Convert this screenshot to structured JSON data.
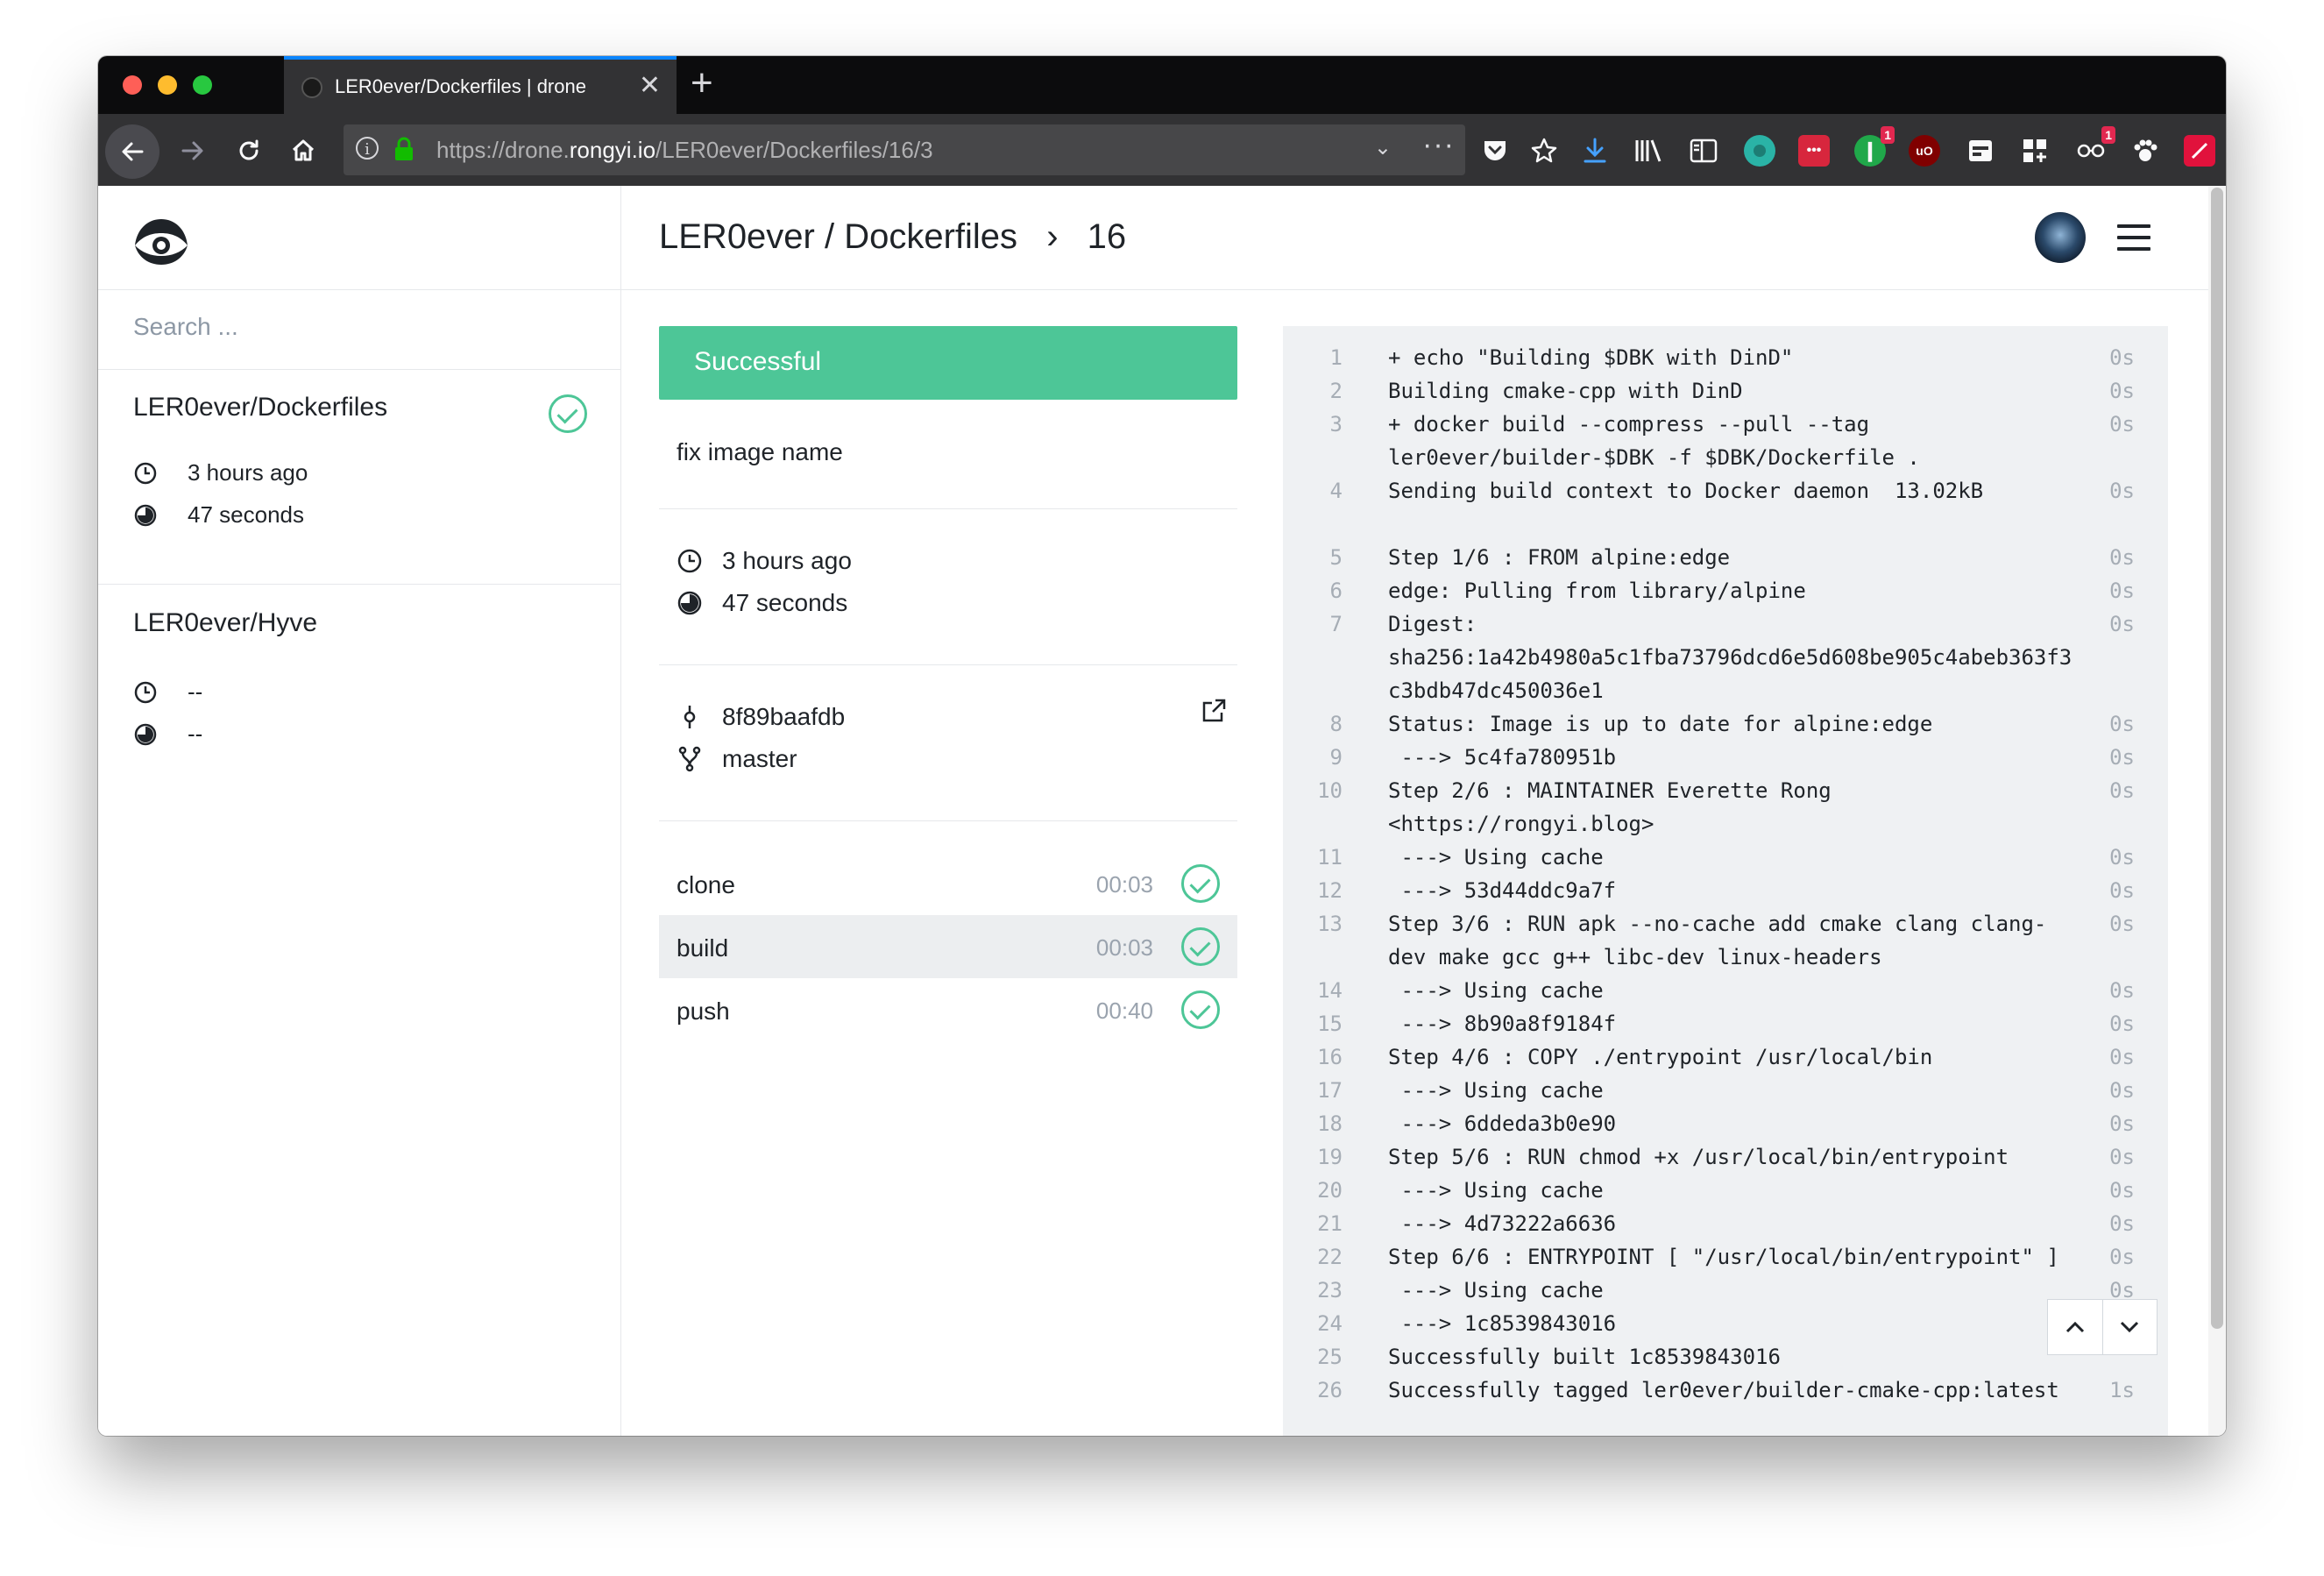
{
  "browser": {
    "tab_title": "LER0ever/Dockerfiles | drone",
    "close_glyph": "✕",
    "new_tab_glyph": "+",
    "url_host_prefix": "https://drone.",
    "url_host_domain": "rongyi.io",
    "url_path": "/LER0ever/Dockerfiles/16/3",
    "toolbar_icons": [
      "download-icon",
      "library-icon",
      "sidebar-icon",
      "extension-teal-icon",
      "extension-red-icon",
      "extension-green-icon",
      "ublock-icon",
      "extension-window-icon",
      "extension-grid-icon",
      "extension-glasses-icon",
      "extension-paw-icon",
      "extension-wand-icon",
      "react-icon",
      "menu-icon"
    ],
    "badges": {
      "green": "1",
      "glasses": "1",
      "red": "1"
    }
  },
  "sidebar": {
    "search_placeholder": "Search ...",
    "repos": [
      {
        "name": "LER0ever/Dockerfiles",
        "time": "3 hours ago",
        "duration": "47 seconds",
        "status": "success"
      },
      {
        "name": "LER0ever/Hyve",
        "time": "--",
        "duration": "--"
      }
    ]
  },
  "header": {
    "owner": "LER0ever",
    "separator": " / ",
    "repo": "Dockerfiles",
    "chevron": "›",
    "build_number": "16"
  },
  "build": {
    "status": "Successful",
    "status_color": "#4dc697",
    "message": "fix image name",
    "time": "3 hours ago",
    "duration": "47 seconds",
    "commit": "8f89baafdb",
    "branch": "master",
    "steps": [
      {
        "name": "clone",
        "duration": "00:03",
        "status": "success"
      },
      {
        "name": "build",
        "duration": "00:03",
        "status": "success",
        "active": true
      },
      {
        "name": "push",
        "duration": "00:40",
        "status": "success"
      }
    ]
  },
  "logs": [
    {
      "num": "1",
      "text": "+ echo \"Building $DBK with DinD\"",
      "time": "0s"
    },
    {
      "num": "2",
      "text": "Building cmake-cpp with DinD",
      "time": "0s"
    },
    {
      "num": "3",
      "text": "+ docker build --compress --pull --tag",
      "time": "0s"
    },
    {
      "num": "",
      "text": "ler0ever/builder-$DBK -f $DBK/Dockerfile .",
      "time": ""
    },
    {
      "num": "4",
      "text": "Sending build context to Docker daemon  13.02kB",
      "time": "0s"
    },
    {
      "num": "",
      "text": "",
      "time": ""
    },
    {
      "num": "5",
      "text": "Step 1/6 : FROM alpine:edge",
      "time": "0s"
    },
    {
      "num": "6",
      "text": "edge: Pulling from library/alpine",
      "time": "0s"
    },
    {
      "num": "7",
      "text": "Digest:",
      "time": "0s"
    },
    {
      "num": "",
      "text": "sha256:1a42b4980a5c1fba73796dcd6e5d608be905c4abeb363f3",
      "time": ""
    },
    {
      "num": "",
      "text": "c3bdb47dc450036e1",
      "time": ""
    },
    {
      "num": "8",
      "text": "Status: Image is up to date for alpine:edge",
      "time": "0s"
    },
    {
      "num": "9",
      "text": " ---> 5c4fa780951b",
      "time": "0s"
    },
    {
      "num": "10",
      "text": "Step 2/6 : MAINTAINER Everette Rong",
      "time": "0s"
    },
    {
      "num": "",
      "text": "<https://rongyi.blog>",
      "time": ""
    },
    {
      "num": "11",
      "text": " ---> Using cache",
      "time": "0s"
    },
    {
      "num": "12",
      "text": " ---> 53d44ddc9a7f",
      "time": "0s"
    },
    {
      "num": "13",
      "text": "Step 3/6 : RUN apk --no-cache add cmake clang clang-",
      "time": "0s"
    },
    {
      "num": "",
      "text": "dev make gcc g++ libc-dev linux-headers",
      "time": ""
    },
    {
      "num": "14",
      "text": " ---> Using cache",
      "time": "0s"
    },
    {
      "num": "15",
      "text": " ---> 8b90a8f9184f",
      "time": "0s"
    },
    {
      "num": "16",
      "text": "Step 4/6 : COPY ./entrypoint /usr/local/bin",
      "time": "0s"
    },
    {
      "num": "17",
      "text": " ---> Using cache",
      "time": "0s"
    },
    {
      "num": "18",
      "text": " ---> 6ddeda3b0e90",
      "time": "0s"
    },
    {
      "num": "19",
      "text": "Step 5/6 : RUN chmod +x /usr/local/bin/entrypoint",
      "time": "0s"
    },
    {
      "num": "20",
      "text": " ---> Using cache",
      "time": "0s"
    },
    {
      "num": "21",
      "text": " ---> 4d73222a6636",
      "time": "0s"
    },
    {
      "num": "22",
      "text": "Step 6/6 : ENTRYPOINT [ \"/usr/local/bin/entrypoint\" ]",
      "time": "0s"
    },
    {
      "num": "23",
      "text": " ---> Using cache",
      "time": "0s"
    },
    {
      "num": "24",
      "text": " ---> 1c8539843016",
      "time": "0s"
    },
    {
      "num": "25",
      "text": "Successfully built 1c8539843016",
      "time": ""
    },
    {
      "num": "26",
      "text": "Successfully tagged ler0ever/builder-cmake-cpp:latest",
      "time": "1s"
    }
  ]
}
